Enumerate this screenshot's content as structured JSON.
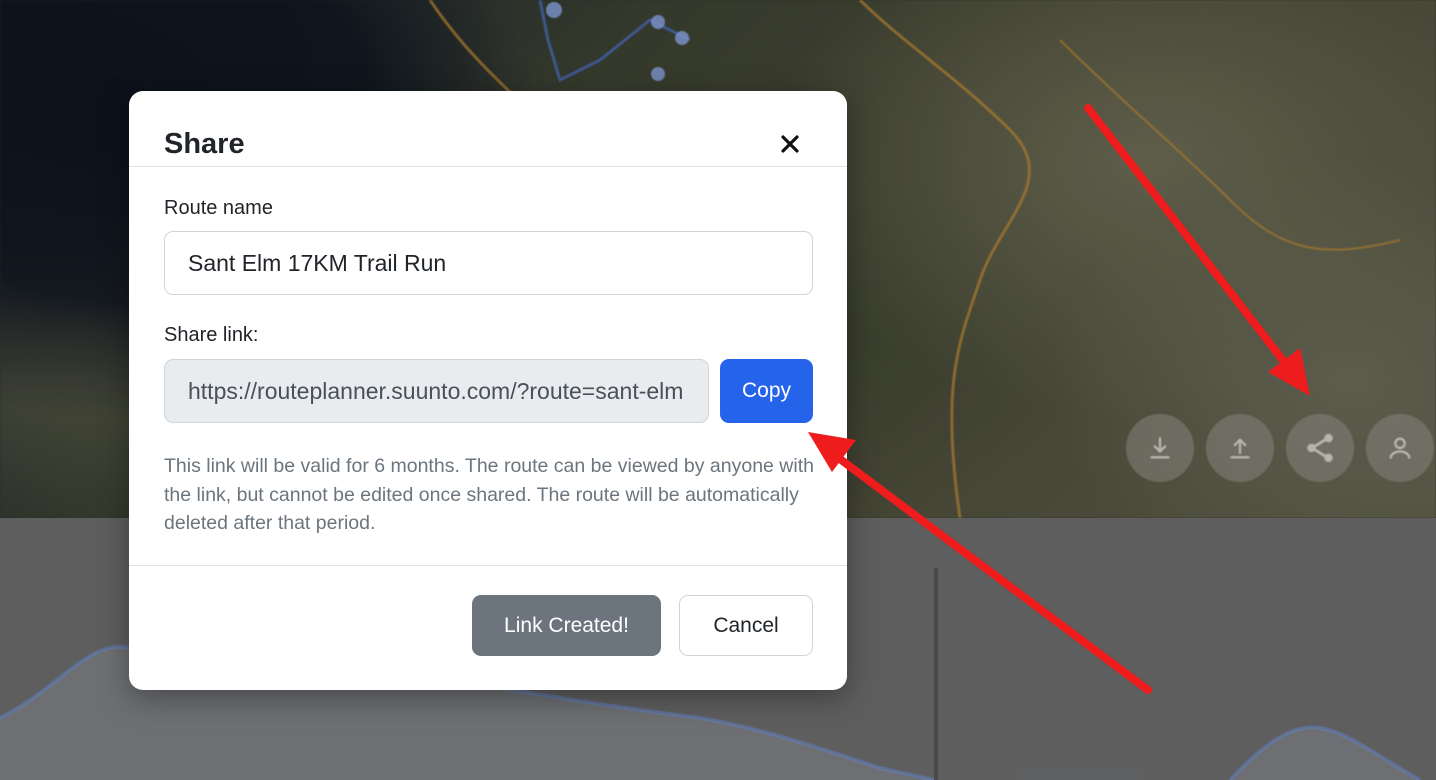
{
  "modal": {
    "title": "Share",
    "route_name_label": "Route name",
    "route_name_value": "Sant Elm 17KM Trail Run",
    "share_link_label": "Share link:",
    "share_link_value": "https://routeplanner.suunto.com/?route=sant-elm",
    "copy_label": "Copy",
    "help_text": "This link will be valid for 6 months. The route can be viewed by anyone with the link, but cannot be edited once shared. The route will be automatically deleted after that period.",
    "link_created_label": "Link Created!",
    "cancel_label": "Cancel"
  },
  "map": {
    "controls": [
      "download-icon",
      "upload-icon",
      "share-icon",
      "person-icon"
    ]
  },
  "colors": {
    "primary": "#2563eb",
    "secondary": "#6c757d",
    "arrow": "#ee1c1c",
    "route_line": "#e2a23b"
  }
}
